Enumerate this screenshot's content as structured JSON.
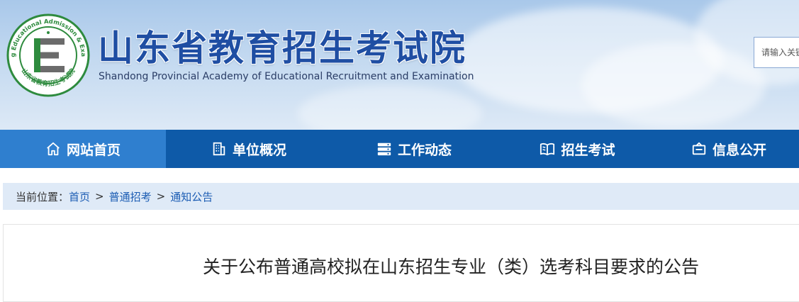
{
  "header": {
    "title": "山东省教育招生考试院",
    "subtitle": "Shandong Provincial Academy of Educational Recruitment and Examination",
    "logo_ring_text": "Shandong Educational Admission & Examination",
    "logo_bottom_text": "山东省教育招生考试院",
    "logo_letter": "E"
  },
  "search": {
    "placeholder": "请输入关键字"
  },
  "nav": {
    "items": [
      {
        "label": "网站首页",
        "icon": "home-icon",
        "active": true
      },
      {
        "label": "单位概况",
        "icon": "building-icon",
        "active": false
      },
      {
        "label": "工作动态",
        "icon": "server-list-icon",
        "active": false
      },
      {
        "label": "招生考试",
        "icon": "open-book-icon",
        "active": false
      },
      {
        "label": "信息公开",
        "icon": "info-box-icon",
        "active": false
      }
    ]
  },
  "breadcrumb": {
    "prefix": "当前位置：",
    "items": [
      "首页",
      "普通招考",
      "通知公告"
    ],
    "separator": ">"
  },
  "article": {
    "title": "关于公布普通高校拟在山东招生专业（类）选考科目要求的公告"
  },
  "colors": {
    "nav_bg": "#0e5aa8",
    "nav_active": "#2f7fcf",
    "title_blue": "#1f4ea3",
    "logo_green": "#2e8b3e",
    "breadcrumb_bg": "#dfeaf7"
  }
}
